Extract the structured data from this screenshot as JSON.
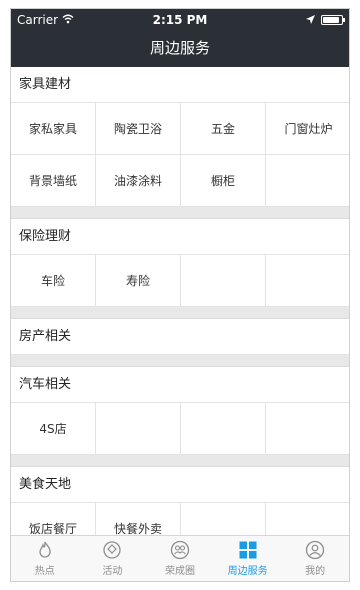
{
  "status": {
    "carrier": "Carrier",
    "time": "2:15 PM"
  },
  "nav": {
    "title": "周边服务"
  },
  "sections": [
    {
      "title": "家具建材",
      "items": [
        "家私家具",
        "陶瓷卫浴",
        "五金",
        "门窗灶炉",
        "背景墙纸",
        "油漆涂料",
        "橱柜",
        ""
      ]
    },
    {
      "title": "保险理财",
      "items": [
        "车险",
        "寿险",
        "",
        ""
      ]
    },
    {
      "title": "房产相关",
      "items": []
    },
    {
      "title": "汽车相关",
      "items": [
        "4S店",
        "",
        "",
        ""
      ]
    },
    {
      "title": "美食天地",
      "items": [
        "饭店餐厅",
        "快餐外卖",
        "",
        ""
      ]
    }
  ],
  "tabs": [
    {
      "label": "热点",
      "icon": "flame-icon",
      "active": false
    },
    {
      "label": "活动",
      "icon": "tag-icon",
      "active": false
    },
    {
      "label": "荣成圈",
      "icon": "group-icon",
      "active": false
    },
    {
      "label": "周边服务",
      "icon": "grid-icon",
      "active": true
    },
    {
      "label": "我的",
      "icon": "user-icon",
      "active": false
    }
  ],
  "colors": {
    "nav_bg": "#2b3036",
    "accent": "#1a9be6",
    "tab_inactive": "#8e8e8e"
  }
}
